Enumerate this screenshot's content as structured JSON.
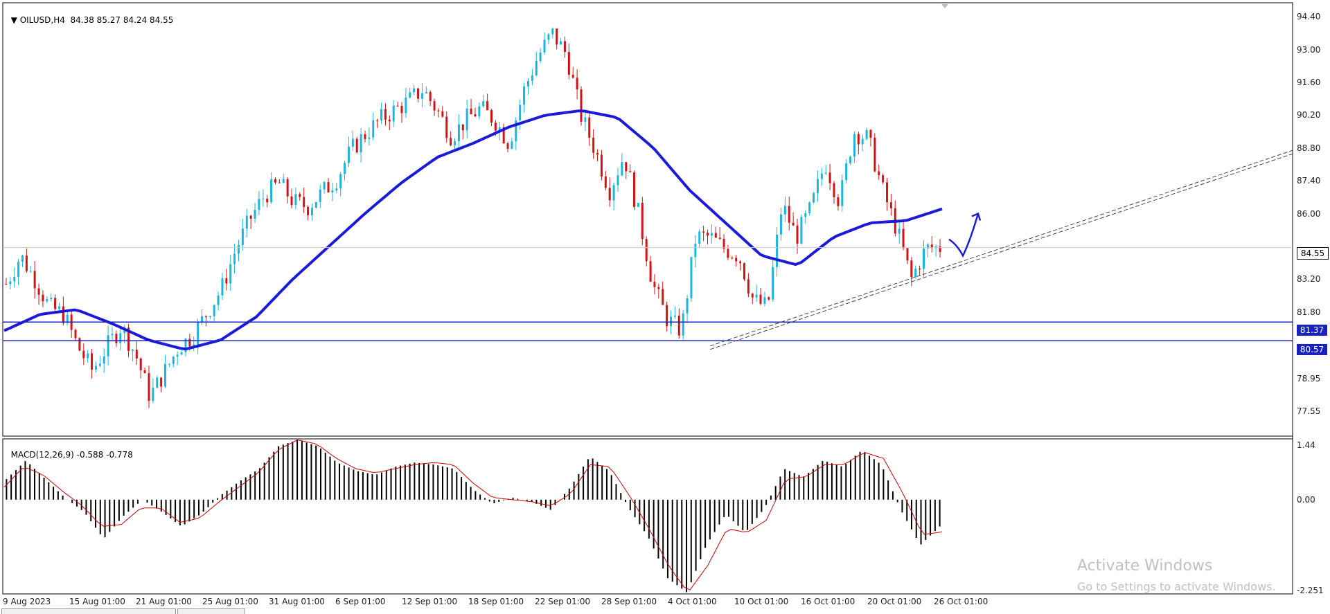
{
  "header": {
    "symbol": "OILUSD,H4",
    "ohlc": "84.38 85.27 84.24 84.55",
    "macd_label": "MACD(12,26,9)",
    "macd_values": "-0.588 -0.778"
  },
  "chart_data": {
    "type": "candlestick",
    "symbol": "OILUSD",
    "timeframe": "H4",
    "ylim": [
      76.5,
      95.0
    ],
    "yticks": [
      "94.40",
      "93.00",
      "91.60",
      "90.20",
      "88.80",
      "87.40",
      "86.00",
      "83.20",
      "81.80",
      "78.95",
      "77.55"
    ],
    "xticks": [
      "9 Aug 2023",
      "15 Aug 01:00",
      "21 Aug 01:00",
      "25 Aug 01:00",
      "31 Aug 01:00",
      "6 Sep 01:00",
      "12 Sep 01:00",
      "18 Sep 01:00",
      "22 Sep 01:00",
      "28 Sep 01:00",
      "4 Oct 01:00",
      "10 Oct 01:00",
      "16 Oct 01:00",
      "20 Oct 01:00",
      "26 Oct 01:00"
    ],
    "current_price": "84.55",
    "horizontal_lines": [
      "81.37",
      "80.57"
    ],
    "price_path": [
      83.0,
      84.2,
      83.2,
      82.0,
      81.7,
      80.3,
      79.3,
      80.3,
      81.2,
      80.0,
      78.2,
      79.2,
      80.3,
      80.8,
      81.8,
      82.8,
      84.5,
      85.8,
      86.8,
      87.3,
      86.5,
      86.3,
      86.9,
      87.5,
      88.7,
      89.4,
      90.0,
      90.4,
      90.8,
      91.3,
      90.4,
      89.3,
      90.0,
      90.5,
      90.0,
      89.0,
      91.2,
      92.7,
      93.7,
      92.8,
      90.2,
      88.7,
      87.0,
      88.5,
      86.0,
      83.0,
      81.5,
      81.0,
      85.0,
      85.0,
      84.5,
      84.2,
      82.3,
      82.0,
      86.4,
      85.0,
      86.2,
      88.2,
      86.5,
      89.5,
      89.2,
      87.0,
      85.3,
      83.2,
      84.5,
      84.55
    ],
    "ma_path": [
      81.0,
      81.7,
      81.9,
      81.3,
      80.6,
      80.2,
      80.6,
      81.6,
      83.2,
      84.6,
      86.0,
      87.3,
      88.4,
      89.0,
      89.7,
      90.2,
      90.4,
      90.1,
      88.8,
      87.0,
      85.6,
      84.2,
      83.8,
      85.0,
      85.6,
      85.7,
      86.2
    ],
    "ma_color": "#1a1ad8",
    "bull_color": "#1bb5e0",
    "bear_color": "#d01414",
    "macd": {
      "label": "MACD(12,26,9)",
      "main": -0.588,
      "signal": -0.778,
      "yticks": [
        "1.44",
        "0.00",
        "-2.251"
      ],
      "ylim": [
        -2.251,
        1.44
      ],
      "hist_path": [
        0.5,
        0.95,
        0.5,
        0.05,
        -0.3,
        -0.95,
        -0.4,
        0.0,
        -0.3,
        -0.65,
        -0.35,
        0.1,
        0.45,
        0.75,
        1.3,
        1.45,
        1.3,
        0.9,
        0.7,
        0.6,
        0.8,
        0.9,
        0.85,
        0.75,
        0.25,
        -0.1,
        0.05,
        -0.05,
        -0.25,
        0.3,
        1.05,
        0.7,
        -0.2,
        -0.9,
        -1.9,
        -2.25,
        -1.1,
        -0.35,
        -0.8,
        -0.2,
        0.75,
        0.55,
        0.95,
        0.8,
        1.2,
        0.85,
        -0.25,
        -1.1,
        -0.65
      ],
      "signal_path": [
        0.3,
        0.8,
        0.6,
        0.2,
        -0.15,
        -0.65,
        -0.6,
        -0.2,
        -0.2,
        -0.55,
        -0.45,
        -0.05,
        0.3,
        0.65,
        1.2,
        1.45,
        1.35,
        1.0,
        0.75,
        0.65,
        0.75,
        0.85,
        0.9,
        0.85,
        0.4,
        0.05,
        0.0,
        -0.05,
        -0.15,
        0.15,
        0.85,
        0.8,
        0.1,
        -0.7,
        -1.6,
        -2.25,
        -1.6,
        -0.7,
        -0.8,
        -0.5,
        0.5,
        0.55,
        0.85,
        0.85,
        1.15,
        1.0,
        0.15,
        -0.85,
        -0.78
      ],
      "hist_color": "#000000",
      "signal_color": "#cc0000"
    }
  },
  "watermark": {
    "title": "Activate Windows",
    "subtitle": "Go to Settings to activate Windows."
  }
}
